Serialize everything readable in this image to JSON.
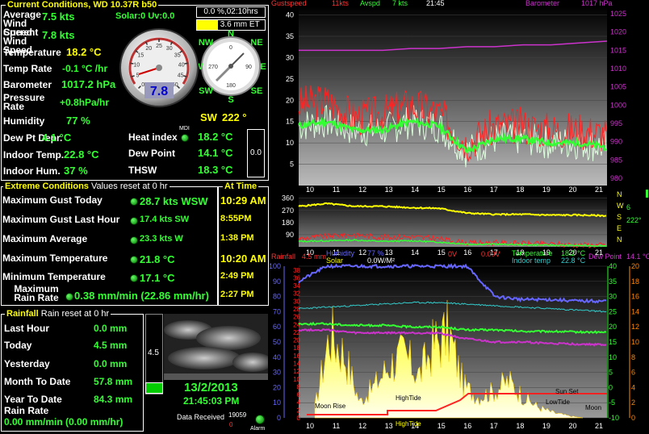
{
  "app_title": "Current Conditions, WD 10.37R b50",
  "current": {
    "avg_wind_label": "Average Wind Speed",
    "avg_wind_value": "7.5 kts",
    "solar_uv": "Solar:0 Uv:0.0",
    "cur_wind_label": "Current Wind Speed",
    "cur_wind_value": "7.8 kts",
    "temp_label": "Temperature",
    "temp_value": "18.2 °C",
    "temp_rate_label": "Temp Rate",
    "temp_rate_value": "-0.1 °C /hr",
    "baro_label": "Barometer",
    "baro_value": "1017.2 hPa",
    "pressure_rate_label": "Pressure Rate",
    "pressure_rate_value": "+0.8hPa/hr",
    "humidity_label": "Humidity",
    "humidity_value": "77 %",
    "dewdep_label": "Dew Pt Depr.",
    "dewdep_value": "4.1 °C",
    "indoor_temp_label": "Indoor Temp.",
    "indoor_temp_value": "22.8 °C",
    "indoor_hum_label": "Indoor Hum.",
    "indoor_hum_value": "37 %",
    "heat_index_label": "Heat index",
    "heat_index_value": "18.2 °C",
    "mdi": "MDI",
    "dew_point_label": "Dew Point",
    "dew_point_value": "14.1 °C",
    "thsw_label": "THSW",
    "thsw_value": "18.3 °C",
    "rain_pct": "0.0 %,02:10hrs",
    "et": "3.6 mm ET",
    "side_box": "0.0",
    "dial_value": "7.8",
    "dial_ticks": [
      "0",
      "5",
      "10",
      "15",
      "20",
      "25",
      "30",
      "35",
      "40",
      "45",
      "50"
    ],
    "compass_dir": "SW",
    "compass_deg": "222 °",
    "compass_labels": {
      "n": "N",
      "ne": "NE",
      "e": "E",
      "se": "SE",
      "s": "S",
      "sw": "SW",
      "w": "W",
      "nw": "NW"
    },
    "compass_degs": [
      "0",
      "90",
      "180",
      "270"
    ]
  },
  "extreme": {
    "title": "Extreme Conditions",
    "reset": "Values reset at 0 hr",
    "time_title": "At Time",
    "rows": [
      {
        "label": "Maximum Gust Today",
        "value": "28.7 kts WSW",
        "time": "10:29 AM"
      },
      {
        "label": "Maximum Gust Last Hour",
        "value": "17.4 kts  SW",
        "time": "8:55PM"
      },
      {
        "label": "Maximum Average",
        "value": "23.3 kts   W",
        "time": "1:38 PM"
      },
      {
        "label": "Maximum Temperature",
        "value": "21.8 °C",
        "time": "10:20 AM"
      },
      {
        "label": "Minimum Temperature",
        "value": "17.1 °C",
        "time": "2:49 PM"
      },
      {
        "label": "Maximum Rain Rate",
        "value": "0.38 mm/min (22.86 mm/hr)",
        "time": "2:27 PM"
      }
    ]
  },
  "rainfall": {
    "title": "Rainfall",
    "reset": "Rain reset at 0 hr",
    "rows": [
      {
        "label": "Last Hour",
        "value": "0.0 mm"
      },
      {
        "label": "Today",
        "value": "4.5 mm"
      },
      {
        "label": "Yesterday",
        "value": "0.0 mm"
      },
      {
        "label": "Month To Date",
        "value": "57.8 mm"
      },
      {
        "label": "Year To Date",
        "value": "84.3 mm"
      }
    ],
    "rate_label": "Rain Rate",
    "rate_value": "0.00 mm/min (0.00 mm/hr)",
    "gauge_value": "4.5",
    "gauge_level": 0.0
  },
  "status": {
    "date": "13/2/2013",
    "time": "21:45:03 PM",
    "received_label": "Data Received",
    "received_count": "19059",
    "received_zero": "0",
    "alarm": "Alarm"
  },
  "graph_top": {
    "header": [
      "Gustspeed",
      "11kts",
      "Avspd",
      "7 kts",
      "21:45",
      "Barometer",
      "1017 hPa"
    ],
    "left_ticks": [
      "40",
      "35",
      "30",
      "25",
      "20",
      "15",
      "10",
      "5"
    ],
    "right_ticks": [
      "1025",
      "1020",
      "1015",
      "1010",
      "1005",
      "1000",
      "995",
      "990",
      "985",
      "980"
    ]
  },
  "graph_mid": {
    "left_ticks": [
      "360",
      "270",
      "180",
      "90"
    ],
    "right": [
      "N",
      "W",
      "S",
      "E",
      "N"
    ],
    "right_vals": [
      "6",
      "222°"
    ]
  },
  "hours": [
    "10",
    "11",
    "12",
    "13",
    "14",
    "15",
    "16",
    "17",
    "18",
    "19",
    "20",
    "21"
  ],
  "graph_bottom": {
    "header": [
      "Rainfall",
      "4.5 mm",
      "Humidity",
      "77 %",
      "0V",
      "0.00V",
      "Temperature",
      "18.2 °C",
      "Dew Point",
      "14.1 °C"
    ],
    "header2": [
      "Solar",
      "0.0W/M²",
      "Indoor temp",
      "22.8 °C"
    ],
    "left_ticks": [
      "100",
      "90",
      "80",
      "70",
      "60",
      "50",
      "40",
      "30",
      "20",
      "10",
      "0"
    ],
    "mid_ticks": [
      "38",
      "36",
      "34",
      "32",
      "30",
      "28",
      "26",
      "24",
      "22",
      "20",
      "18",
      "16",
      "14",
      "12",
      "10",
      "8",
      "6",
      "4",
      "2",
      "0"
    ],
    "right_ticks_g": [
      "40",
      "35",
      "30",
      "25",
      "20",
      "15",
      "10",
      "5",
      "0",
      "-5",
      "-10"
    ],
    "right_ticks_o": [
      "20",
      "18",
      "16",
      "14",
      "12",
      "10",
      "8",
      "6",
      "4",
      "2",
      "0"
    ],
    "annotations": [
      "Moon Rise",
      "HighTide",
      "Sun Set",
      "LowTide",
      "Moon",
      "HighTide"
    ]
  },
  "colors": {
    "green": "#33ff33",
    "yellow": "#ffff00",
    "red": "#ff2222",
    "magenta": "#cc33cc",
    "cyan": "#33cccc",
    "blue": "#6666ff",
    "orange": "#ff8800"
  },
  "chart_data": [
    {
      "type": "line",
      "title": "",
      "x": [
        "10",
        "11",
        "12",
        "13",
        "14",
        "15",
        "16",
        "17",
        "18",
        "19",
        "20",
        "21"
      ],
      "series": [
        {
          "name": "Gustspeed",
          "values": [
            19,
            20,
            16,
            17,
            19,
            17,
            10,
            14,
            14,
            13,
            13,
            12
          ]
        },
        {
          "name": "Avspd",
          "values": [
            14,
            15,
            13,
            13,
            15,
            14,
            8,
            11,
            11,
            10,
            10,
            9
          ]
        },
        {
          "name": "Barometer",
          "values": [
            1015,
            1015,
            1015,
            1015,
            1015.5,
            1015.5,
            1016,
            1016,
            1016.5,
            1016.5,
            1017,
            1017.5
          ]
        }
      ],
      "ylim": [
        0,
        42
      ]
    },
    {
      "type": "line",
      "title": "",
      "x": [
        "10",
        "11",
        "12",
        "13",
        "14",
        "15",
        "16",
        "17",
        "18",
        "19",
        "20",
        "21"
      ],
      "series": [
        {
          "name": "",
          "values": [
            300,
            320,
            300,
            300,
            290,
            285,
            250,
            240,
            240,
            235,
            235,
            230
          ]
        }
      ],
      "ylim": [
        0,
        360
      ]
    },
    {
      "type": "area",
      "title": "",
      "x": [
        "10",
        "11",
        "12",
        "13",
        "14",
        "15",
        "16",
        "17",
        "18",
        "19",
        "20",
        "21"
      ],
      "series": [
        {
          "name": "Humidity",
          "values": [
            90,
            100,
            100,
            100,
            100,
            100,
            100,
            80,
            78,
            78,
            77,
            77
          ]
        },
        {
          "name": "Temperature",
          "values": [
            21,
            21,
            20.5,
            20.5,
            20,
            20,
            19,
            19,
            18.5,
            18.5,
            18.3,
            18.2
          ]
        },
        {
          "name": "Dew Point",
          "values": [
            19,
            19,
            18,
            18,
            18,
            18,
            16,
            15,
            15,
            14.5,
            14.3,
            14.1
          ]
        }
      ],
      "ylim": [
        0,
        100
      ]
    }
  ]
}
